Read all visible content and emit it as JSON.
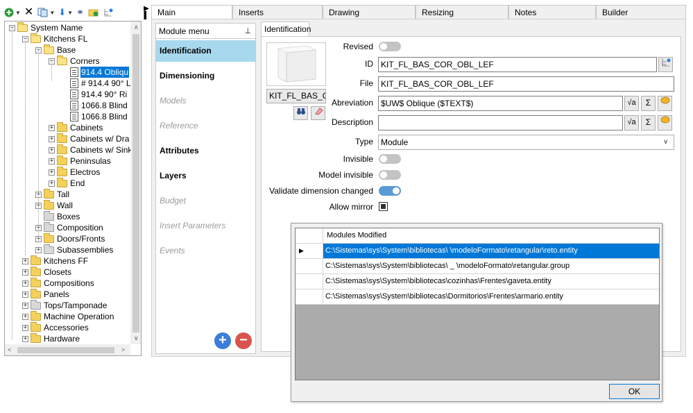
{
  "toolbar": {
    "icons": [
      "add-circle-icon",
      "delete-x-icon",
      "copy-icon",
      "arrow-down-icon",
      "binoculars-icon",
      "folder-refresh-icon",
      "tree-tool-icon"
    ]
  },
  "tree": [
    {
      "label": "System Name",
      "depth": 0,
      "kind": "folder",
      "open": true
    },
    {
      "label": "Kitchens FL",
      "depth": 1,
      "kind": "folder",
      "open": true
    },
    {
      "label": "Base",
      "depth": 2,
      "kind": "folder",
      "open": true
    },
    {
      "label": "Corners",
      "depth": 3,
      "kind": "folder",
      "open": true
    },
    {
      "label": "914.4 Obliqu",
      "depth": 4,
      "kind": "doc",
      "selected": true
    },
    {
      "label": "# 914.4 90° L",
      "depth": 4,
      "kind": "doc"
    },
    {
      "label": "914.4 90° Ri",
      "depth": 4,
      "kind": "doc"
    },
    {
      "label": "1066.8 Blind",
      "depth": 4,
      "kind": "doc"
    },
    {
      "label": "1066.8 Blind",
      "depth": 4,
      "kind": "doc"
    },
    {
      "label": "Cabinets",
      "depth": 3,
      "kind": "folder"
    },
    {
      "label": "Cabinets w/ Dra",
      "depth": 3,
      "kind": "folder"
    },
    {
      "label": "Cabinets w/ Sink",
      "depth": 3,
      "kind": "folder"
    },
    {
      "label": "Peninsulas",
      "depth": 3,
      "kind": "folder"
    },
    {
      "label": "Electros",
      "depth": 3,
      "kind": "folder"
    },
    {
      "label": "End",
      "depth": 3,
      "kind": "folder"
    },
    {
      "label": "Tall",
      "depth": 2,
      "kind": "folder"
    },
    {
      "label": "Wall",
      "depth": 2,
      "kind": "folder"
    },
    {
      "label": "Boxes",
      "depth": 2,
      "kind": "folder-gray",
      "noexp": true
    },
    {
      "label": "Composition",
      "depth": 2,
      "kind": "folder-gray"
    },
    {
      "label": "Doors/Fronts",
      "depth": 2,
      "kind": "folder"
    },
    {
      "label": "Subassemblies",
      "depth": 2,
      "kind": "folder-gray"
    },
    {
      "label": "Kitchens FF",
      "depth": 1,
      "kind": "folder"
    },
    {
      "label": "Closets",
      "depth": 1,
      "kind": "folder"
    },
    {
      "label": "Compositions",
      "depth": 1,
      "kind": "folder"
    },
    {
      "label": "Panels",
      "depth": 1,
      "kind": "folder"
    },
    {
      "label": "Tops/Tamponade",
      "depth": 1,
      "kind": "folder-gray"
    },
    {
      "label": "Machine Operation",
      "depth": 1,
      "kind": "folder"
    },
    {
      "label": "Accessories",
      "depth": 1,
      "kind": "folder"
    },
    {
      "label": "Hardware",
      "depth": 1,
      "kind": "folder"
    }
  ],
  "tabs": [
    "Main",
    "Inserts",
    "Drawing",
    "Resizing",
    "Notes",
    "Builder"
  ],
  "module_menu": {
    "header": "Module menu",
    "items": [
      {
        "label": "Identification",
        "style": "bold",
        "active": true
      },
      {
        "label": "Dimensioning",
        "style": "bold"
      },
      {
        "label": "Models",
        "style": "disabled"
      },
      {
        "label": "Reference",
        "style": "disabled"
      },
      {
        "label": "Attributes",
        "style": "bold"
      },
      {
        "label": "Layers",
        "style": "bold"
      },
      {
        "label": "Budget",
        "style": "disabled"
      },
      {
        "label": "Insert Parameters",
        "style": "disabled"
      },
      {
        "label": "Events",
        "style": "disabled"
      }
    ]
  },
  "identification": {
    "tab_label": "Identification",
    "preview_name": "KIT_FL_BAS_COR_OBL_LEF",
    "labels": {
      "revised": "Revised",
      "id": "ID",
      "file": "File",
      "abreviation": "Abreviation",
      "description": "Description",
      "type": "Type",
      "invisible": "Invisible",
      "model_invisible": "Model invisible",
      "validate": "Validate dimension changed",
      "allow_mirror": "Allow mirror"
    },
    "values": {
      "id": "KIT_FL_BAS_COR_OBL_LEF",
      "file": "KIT_FL_BAS_COR_OBL_LEF",
      "abreviation": "$UW$ Oblique ($TEXT$)",
      "description": "",
      "type": "Module"
    },
    "toggles": {
      "revised": false,
      "invisible": false,
      "model_invisible": false,
      "validate": true
    },
    "allow_mirror": true
  },
  "dialog": {
    "column_header": "Modules Modified",
    "rows": [
      {
        "path": "C:\\Sistemas\\sys\\System\\bibliotecas\\         \\modeloFormato\\retangular\\reto.entity",
        "selected": true
      },
      {
        "path": "C:\\Sistemas\\sys\\System\\bibliotecas\\        _     \\modeloFormato\\retangular.group"
      },
      {
        "path": "C:\\Sistemas\\sys\\System\\bibliotecas\\cozinhas\\Frentes\\gaveta.entity"
      },
      {
        "path": "C:\\Sistemas\\sys\\System\\bibliotecas\\Dormitorios\\Frentes\\armario.entity"
      }
    ],
    "ok_label": "OK"
  }
}
